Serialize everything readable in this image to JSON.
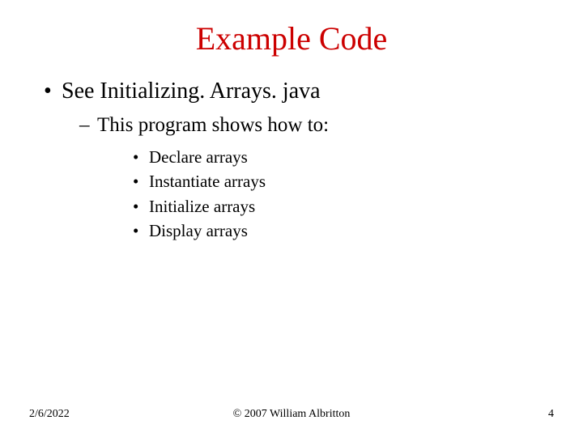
{
  "title": "Example Code",
  "bullet1": "See Initializing. Arrays. java",
  "sub1": "This program shows how to:",
  "items": {
    "0": "Declare arrays",
    "1": "Instantiate arrays",
    "2": "Initialize arrays",
    "3": "Display arrays"
  },
  "footer": {
    "date": "2/6/2022",
    "copyright": "© 2007 William Albritton",
    "page": "4"
  }
}
